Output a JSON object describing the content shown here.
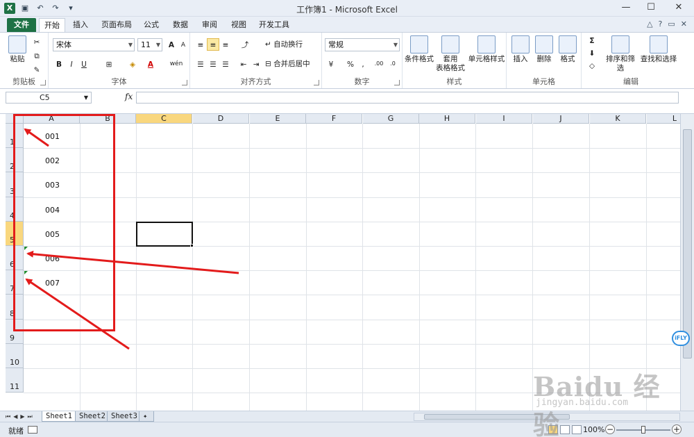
{
  "window": {
    "title": "工作簿1 - Microsoft Excel",
    "app_icon": "X",
    "controls": {
      "minimize": "—",
      "maximize": "☐",
      "close": "✕"
    }
  },
  "ribbon_tabs": [
    "文件",
    "开始",
    "插入",
    "页面布局",
    "公式",
    "数据",
    "审阅",
    "视图",
    "开发工具"
  ],
  "ribbon": {
    "clipboard": {
      "paste": "粘贴",
      "label": "剪贴板"
    },
    "font": {
      "name": "宋体",
      "size": "11",
      "bold": "B",
      "italic": "I",
      "underline": "U",
      "grow": "A",
      "shrink": "A",
      "color": "A",
      "phonetic": "wén",
      "label": "字体"
    },
    "alignment": {
      "wrap": "自动换行",
      "merge": "合并后居中",
      "label": "对齐方式"
    },
    "number": {
      "format": "常规",
      "percent": "%",
      "comma": ",",
      "inc": ".00",
      "dec": ".0",
      "label": "数字"
    },
    "styles": {
      "conditional": "条件格式",
      "table_l1": "套用",
      "table_l2": "表格格式",
      "cell": "单元格样式",
      "label": "样式"
    },
    "cells": {
      "insert": "插入",
      "delete": "删除",
      "format": "格式",
      "label": "单元格"
    },
    "editing": {
      "sigma": "Σ",
      "sort": "排序和筛选",
      "find": "查找和选择",
      "label": "编辑"
    }
  },
  "formula_bar": {
    "name_box": "C5",
    "fx": "fx",
    "value": ""
  },
  "columns": [
    "A",
    "B",
    "C",
    "D",
    "E",
    "F",
    "G",
    "H",
    "I",
    "J",
    "K",
    "L"
  ],
  "rows": [
    "1",
    "2",
    "3",
    "4",
    "5",
    "6",
    "7",
    "8",
    "9",
    "10",
    "11"
  ],
  "cells": {
    "A1": "001",
    "A2": "002",
    "A3": "003",
    "A4": "004",
    "A5": "005",
    "A6": "006",
    "A7": "007"
  },
  "selected_cell": "C5",
  "sheets": [
    "Sheet1",
    "Sheet2",
    "Sheet3"
  ],
  "status": {
    "ready": "就绪",
    "zoom": "100%",
    "minus": "−",
    "plus": "+"
  },
  "watermark": {
    "main": "Baidu 经验",
    "sub": "jingyan.baidu.com"
  },
  "ifly_badge": "iFLY",
  "annotation_color": "#e31b1b",
  "accent_color": "#1e7145"
}
